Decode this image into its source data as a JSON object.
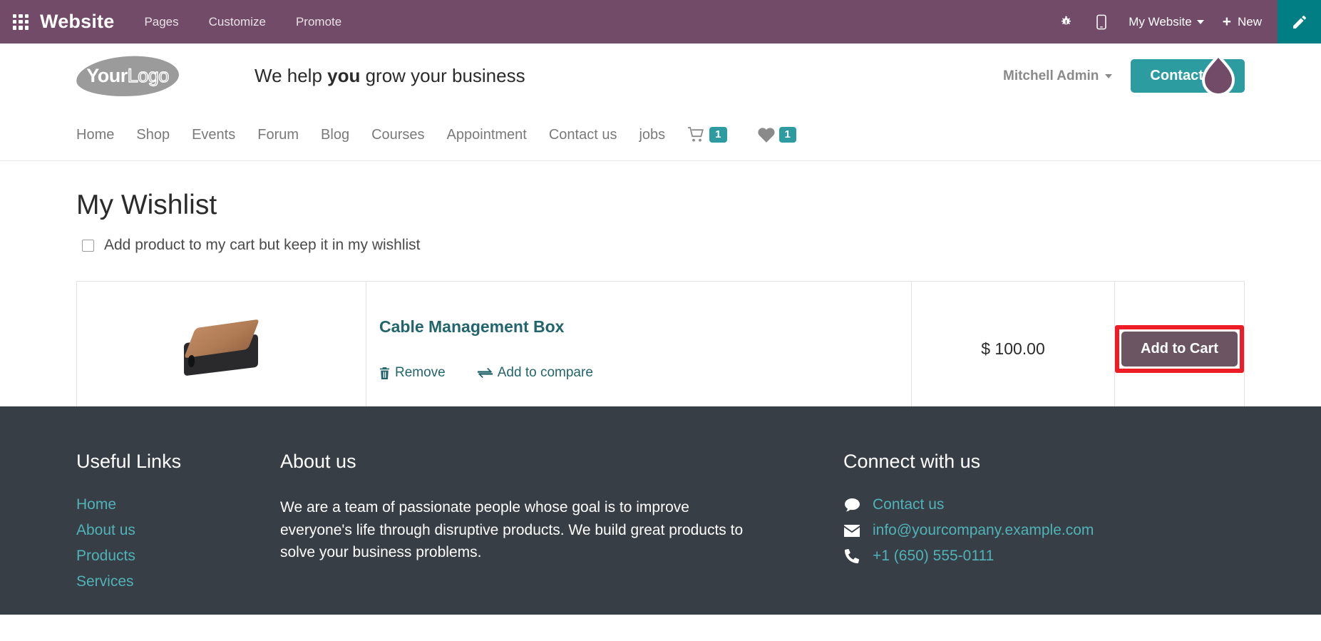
{
  "odoo_navbar": {
    "apps_icon": "apps-grid-icon",
    "brand": "Website",
    "menu_items": [
      {
        "label": "Pages"
      },
      {
        "label": "Customize"
      },
      {
        "label": "Promote"
      }
    ],
    "bug_icon": "bug-icon",
    "mobile_icon": "mobile-preview-icon",
    "website_selector": "My Website",
    "new_label": "New",
    "new_plus": "+",
    "edit_icon": "pencil-edit-icon",
    "bg_color": "#714B67",
    "edit_bg_color": "#017e84"
  },
  "site_header": {
    "logo": {
      "your": "Your",
      "logo": "Logo"
    },
    "tagline_before": "We help ",
    "tagline_bold": "you",
    "tagline_after": " grow your business",
    "user_name": "Mitchell Admin",
    "contact_button": "Contact Us",
    "pin_marker_icon": "map-pin-teardrop-icon",
    "accent_color": "#2d9ca0"
  },
  "site_nav": {
    "links": [
      {
        "label": "Home"
      },
      {
        "label": "Shop"
      },
      {
        "label": "Events"
      },
      {
        "label": "Forum"
      },
      {
        "label": "Blog"
      },
      {
        "label": "Courses"
      },
      {
        "label": "Appointment"
      },
      {
        "label": "Contact us"
      },
      {
        "label": "jobs"
      }
    ],
    "cart": {
      "icon": "shopping-cart-icon",
      "count": "1"
    },
    "wishlist": {
      "icon": "heart-icon",
      "count": "1"
    },
    "badge_color": "#2d9ca0"
  },
  "main": {
    "page_title": "My Wishlist",
    "keep_in_wishlist_label": "Add product to my cart but keep it in my wishlist",
    "keep_in_wishlist_checked": false,
    "products": [
      {
        "image_alt": "Cable Management Box product photo",
        "name": "Cable Management Box",
        "remove_label": "Remove",
        "remove_icon": "trash-icon",
        "compare_label": "Add to compare",
        "compare_icon": "exchange-arrows-icon",
        "price": "$ 100.00",
        "add_to_cart_label": "Add to Cart"
      }
    ],
    "highlight_color": "#ee1c25",
    "add_to_cart_color": "#6b5562"
  },
  "footer": {
    "bg_color": "#373E45",
    "link_color": "#4fb3b8",
    "useful_links": {
      "heading": "Useful Links",
      "items": [
        {
          "label": "Home"
        },
        {
          "label": "About us"
        },
        {
          "label": "Products"
        },
        {
          "label": "Services"
        }
      ]
    },
    "about": {
      "heading": "About us",
      "text": "We are a team of passionate people whose goal is to improve everyone's life through disruptive products. We build great products to solve your business problems."
    },
    "connect": {
      "heading": "Connect with us",
      "items": [
        {
          "icon": "comment-icon",
          "label": "Contact us"
        },
        {
          "icon": "envelope-icon",
          "label": "info@yourcompany.example.com"
        },
        {
          "icon": "phone-icon",
          "label": "+1 (650) 555-0111"
        }
      ]
    }
  }
}
